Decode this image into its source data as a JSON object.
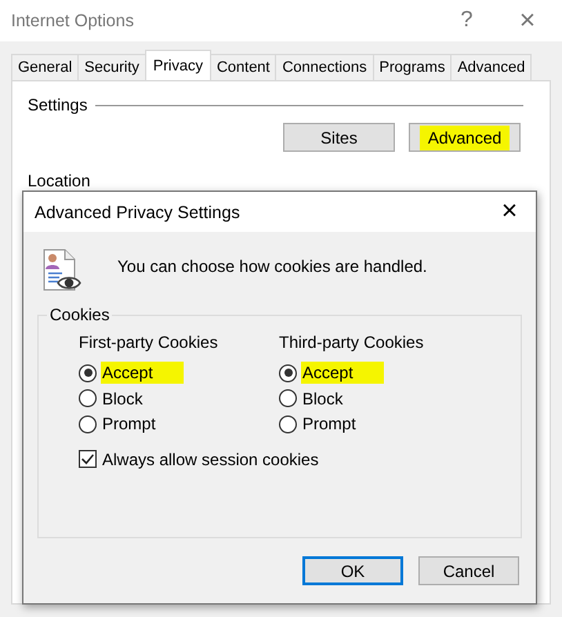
{
  "window": {
    "title": "Internet Options",
    "help_button": "?",
    "close_button": "×"
  },
  "tabs": [
    {
      "label": "General",
      "selected": false
    },
    {
      "label": "Security",
      "selected": false
    },
    {
      "label": "Privacy",
      "selected": true
    },
    {
      "label": "Content",
      "selected": false
    },
    {
      "label": "Connections",
      "selected": false
    },
    {
      "label": "Programs",
      "selected": false
    },
    {
      "label": "Advanced",
      "selected": false
    }
  ],
  "settings": {
    "heading": "Settings",
    "buttons": [
      {
        "label": "Sites",
        "highlighted": false
      },
      {
        "label": "Advanced",
        "highlighted": true
      }
    ]
  },
  "location": {
    "heading": "Location"
  },
  "dialog": {
    "title": "Advanced Privacy Settings",
    "close_button": "×",
    "message": "You can choose how cookies are handled.",
    "group": "Cookies",
    "columns": [
      {
        "heading": "First-party Cookies",
        "options": [
          {
            "label": "Accept",
            "selected": true,
            "highlighted": true
          },
          {
            "label": "Block",
            "selected": false,
            "highlighted": false
          },
          {
            "label": "Prompt",
            "selected": false,
            "highlighted": false
          }
        ]
      },
      {
        "heading": "Third-party Cookies",
        "options": [
          {
            "label": "Accept",
            "selected": true,
            "highlighted": true
          },
          {
            "label": "Block",
            "selected": false,
            "highlighted": false
          },
          {
            "label": "Prompt",
            "selected": false,
            "highlighted": false
          }
        ]
      }
    ],
    "session_cookies": {
      "label": "Always allow session cookies",
      "checked": true
    },
    "buttons": [
      {
        "label": "OK",
        "default": true
      },
      {
        "label": "Cancel",
        "default": false
      }
    ]
  }
}
